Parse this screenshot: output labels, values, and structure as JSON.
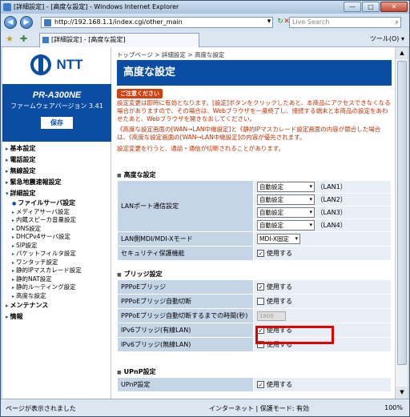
{
  "window": {
    "title": "[詳細設定] - [高度な設定] - Windows Internet Explorer",
    "min": "—",
    "max": "□",
    "close": "✕"
  },
  "address": {
    "url": "http://192.168.1.1/index.cgi/other_main",
    "search_placeholder": "Live Search"
  },
  "tab": {
    "label": "[詳細設定] - [高度な設定]",
    "tools": "ツール(O) ▾"
  },
  "brand": {
    "name": "NTT",
    "model": "PR-A300NE",
    "firmware": "ファームウェアバージョン 3.41",
    "save": "保存"
  },
  "menu": {
    "m1": "基本設定",
    "m2": "電話設定",
    "m3": "無線設定",
    "m4": "緊急地震速報設定",
    "m5": "詳細設定",
    "subs": [
      "ファイルサーバ設定",
      "メディアサーバ設定",
      "内蔵スピーカ音量設定",
      "DNS設定",
      "DHCPv4サーバ設定",
      "SIP設定",
      "パケットフィルタ設定",
      "ワンタッチ設定",
      "静的IPマスカレード設定",
      "静的NAT設定",
      "静的ルーティング設定",
      "高度な設定"
    ],
    "m6": "メンテナンス",
    "m7": "情報"
  },
  "page": {
    "breadcrumb": "トップページ > 詳細設定 > 高度な設定",
    "title": "高度な設定",
    "notice_label": "ご注意ください",
    "notice1": "設定変更は即時に有効となります。[設定]ボタンをクリックしたあと、本商品にアクセスできなくなる場合がありますので、その場合は、Webブラウザを一度終了し、接続する端末と本商品の設定をあわせたあと、Webブラウザを開きなおしてください。",
    "notice2": "《高度な設定画面の[WAN→LAN中継設定]と《静的IPマスカレード設定画面の内容が競合した場合は、《高度な設定画面の[WAN→LAN中継設定]の内容が優先されます。",
    "notice3": "設定変更を行うと、通話・通信が切断されることがあります。"
  },
  "sections": {
    "advanced": "高度な設定",
    "bridge": "ブリッジ設定",
    "upnp": "UPnP設定"
  },
  "advanced": {
    "lan_port_label": "LANポート通信設定",
    "lan_ports": [
      {
        "value": "自動設定",
        "port": "（LAN1）"
      },
      {
        "value": "自動設定",
        "port": "（LAN2）"
      },
      {
        "value": "自動設定",
        "port": "（LAN3）"
      },
      {
        "value": "自動設定",
        "port": "（LAN4）"
      }
    ],
    "mdi_label": "LAN側MDI/MDI-Xモード",
    "mdi_value": "MDI-X固定",
    "security_label": "セキュリティ保護機能",
    "security_value": "使用する"
  },
  "bridge": {
    "pppoe_label": "PPPoEブリッジ",
    "pppoe_value": "使用する",
    "auto_cut_label": "PPPoEブリッジ自動切断",
    "auto_cut_value": "使用する",
    "cut_time_label": "PPPoEブリッジ自動切断するまでの時間(秒)",
    "cut_time_value": "1800",
    "ipv6_wired_label": "IPv6ブリッジ(有線LAN)",
    "ipv6_wired_value": "使用する",
    "ipv6_wireless_label": "IPv6ブリッジ(無線LAN)",
    "ipv6_wireless_value": "使用する"
  },
  "upnp": {
    "label": "UPnP設定",
    "value": "使用する"
  },
  "status": {
    "left": "ページが表示されました",
    "zone": "インターネット | 保護モード: 有効",
    "zoom": "100%"
  }
}
